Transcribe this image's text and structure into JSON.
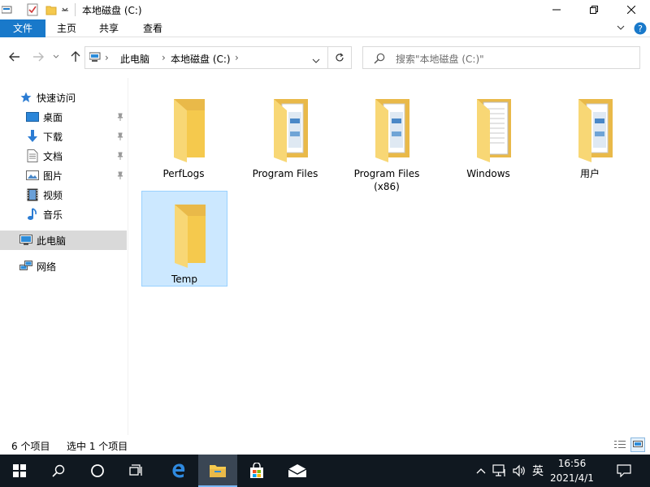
{
  "window": {
    "title": "本地磁盘 (C:)"
  },
  "ribbon": {
    "tabs": [
      "文件",
      "主页",
      "共享",
      "查看"
    ]
  },
  "address": {
    "crumbs": [
      "此电脑",
      "本地磁盘 (C:)"
    ]
  },
  "search": {
    "placeholder": "搜索\"本地磁盘 (C:)\""
  },
  "sidebar": {
    "quick_access": "快速访问",
    "items": [
      {
        "label": "桌面",
        "icon": "desktop-icon",
        "pinned": true
      },
      {
        "label": "下载",
        "icon": "download-icon",
        "pinned": true
      },
      {
        "label": "文档",
        "icon": "document-icon",
        "pinned": true
      },
      {
        "label": "图片",
        "icon": "pictures-icon",
        "pinned": true
      },
      {
        "label": "视频",
        "icon": "video-icon",
        "pinned": false
      },
      {
        "label": "音乐",
        "icon": "music-icon",
        "pinned": false
      }
    ],
    "this_pc": "此电脑",
    "network": "网络"
  },
  "files": [
    {
      "name": "PerfLogs",
      "type": "folder-empty"
    },
    {
      "name": "Program Files",
      "type": "folder-docs"
    },
    {
      "name": "Program Files\n(x86)",
      "type": "folder-docs"
    },
    {
      "name": "Windows",
      "type": "folder-papers"
    },
    {
      "name": "用户",
      "type": "folder-docs"
    },
    {
      "name": "Temp",
      "type": "folder-empty",
      "selected": true
    }
  ],
  "status": {
    "count": "6 个项目",
    "selection": "选中 1 个项目"
  },
  "taskbar": {
    "language": "英",
    "time": "16:56",
    "date": "2021/4/1"
  },
  "colors": {
    "accent": "#1979ca",
    "folder": "#f5c94d",
    "selection_bg": "#cce8ff",
    "taskbar": "#101820"
  }
}
